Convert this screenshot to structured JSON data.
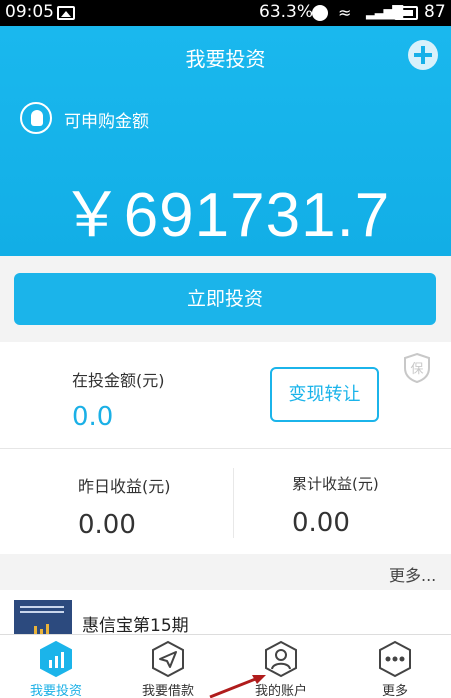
{
  "status_bar": {
    "time": "09:05",
    "battery_percent": "63.3%",
    "battery_level": "87"
  },
  "header": {
    "title": "我要投资",
    "amount_label": "可申购金额",
    "amount": "￥691731.7"
  },
  "invest_button": "立即投资",
  "holdings": {
    "invest_amount_label": "在投金额(元)",
    "invest_amount_value": "0.0",
    "cashout_button": "变现转让",
    "shield_text": "保",
    "yesterday_label": "昨日收益(元)",
    "yesterday_value": "0.00",
    "total_label": "累计收益(元)",
    "total_value": "0.00"
  },
  "more_link": "更多...",
  "product": {
    "name": "惠信宝第15期"
  },
  "tabs": [
    {
      "label": "我要投资",
      "icon": "chart-icon",
      "active": true
    },
    {
      "label": "我要借款",
      "icon": "paper-plane-icon",
      "active": false
    },
    {
      "label": "我的账户",
      "icon": "user-icon",
      "active": false
    },
    {
      "label": "更多",
      "icon": "more-dots-icon",
      "active": false
    }
  ],
  "colors": {
    "accent": "#1bb4ea",
    "annotation_arrow": "#b01c1c"
  }
}
